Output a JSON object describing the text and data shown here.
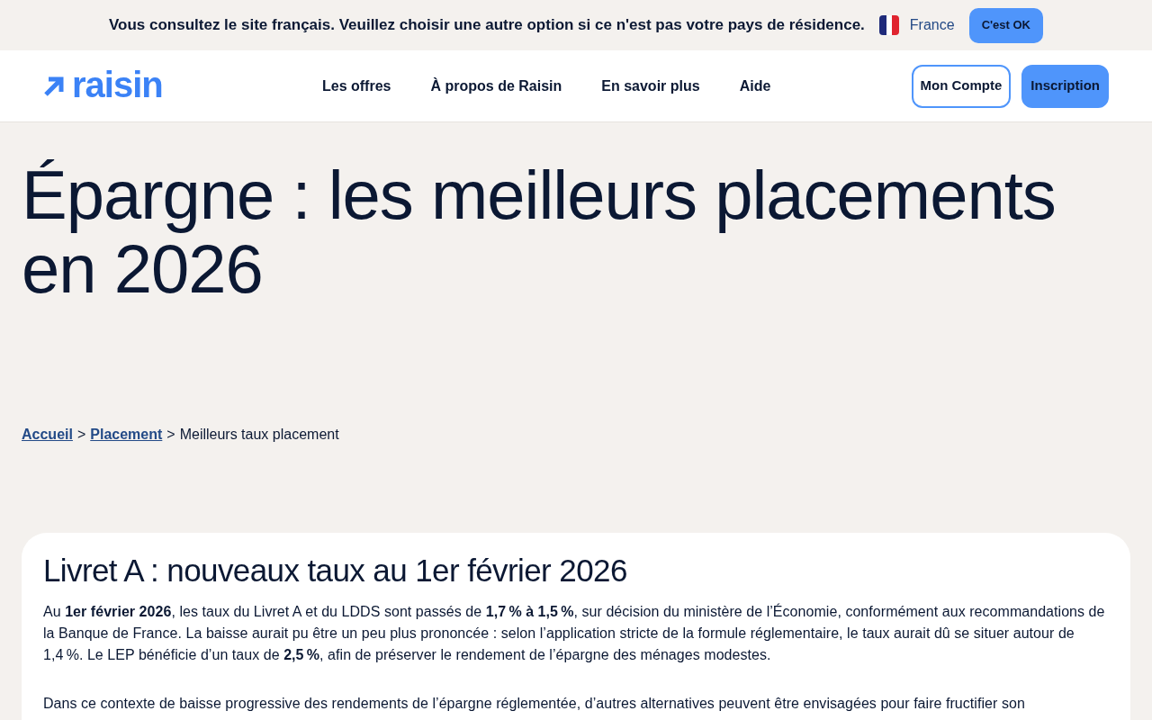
{
  "country_banner": {
    "message": "Vous consultez le site français. Veuillez choisir une autre option si ce n'est pas votre pays de résidence.",
    "country": "France",
    "confirm_button": "C'est OK"
  },
  "header": {
    "logo": "raisin",
    "nav": [
      "Les offres",
      "À propos de Raisin",
      "En savoir plus",
      "Aide"
    ],
    "buttons": [
      {
        "label": "Mon Compte",
        "kind": "outline"
      },
      {
        "label": "Inscription",
        "kind": "filled"
      }
    ]
  },
  "page_title": "Épargne : les meilleurs placements en 2026",
  "breadcrumb": [
    {
      "label": "Accueil",
      "kind": "link"
    },
    {
      "label": ">",
      "kind": "separator"
    },
    {
      "label": "Placement",
      "kind": "link"
    },
    {
      "label": ">",
      "kind": "separator"
    },
    {
      "label": "Meilleurs taux placement",
      "kind": "current"
    }
  ],
  "article": {
    "heading": "Livret A : nouveaux taux au 1er février 2026",
    "paragraphs": [
      "Au **1er février 2026**, les taux du Livret A et du LDDS sont passés de **1,7 % à 1,5 %**, sur décision du ministère de l’Économie, conformément aux recommandations de la Banque de France. La baisse aurait pu être un peu plus prononcée : selon l’application stricte de la formule réglementaire, le taux aurait dû se situer autour de 1,4 %. Le LEP bénéficie d’un taux de **2,5 %**, afin de préserver le rendement de l’épargne des ménages modestes.",
      "Dans ce contexte de baisse progressive des rendements de l’épargne réglementée, d’autres alternatives peuvent être envisagées pour faire fructifier son"
    ]
  }
}
